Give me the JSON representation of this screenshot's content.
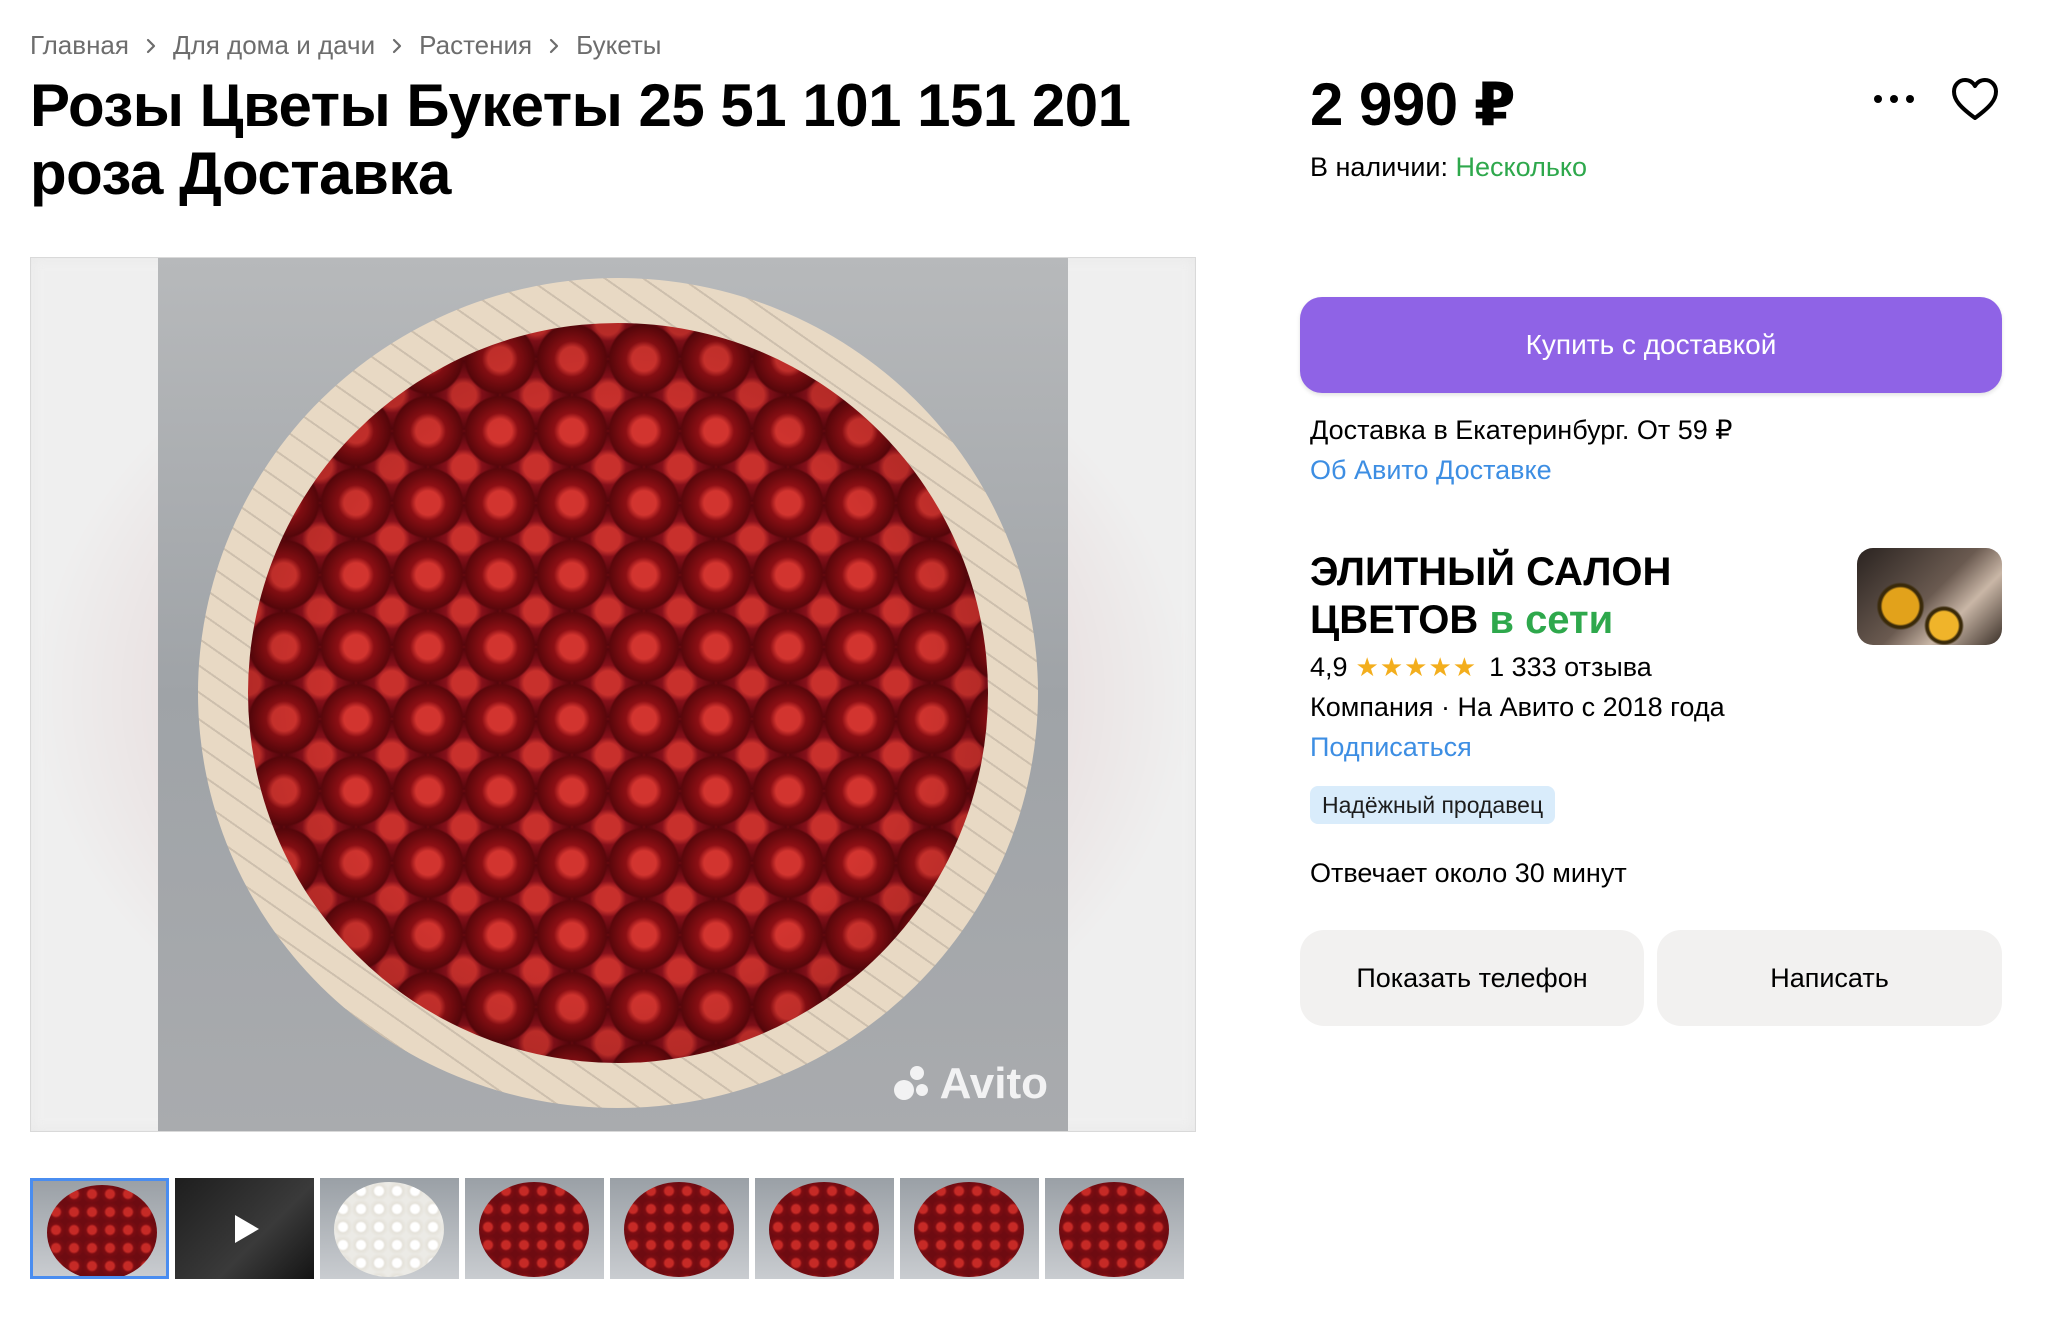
{
  "breadcrumbs": [
    "Главная",
    "Для дома и дачи",
    "Растения",
    "Букеты"
  ],
  "title": "Розы Цветы Букеты 25 51 101 151 201 роза Доставка",
  "gallery": {
    "watermark": "Avito",
    "thumbnails": [
      {
        "kind": "photo",
        "active": true
      },
      {
        "kind": "video",
        "icon": "play-icon"
      },
      {
        "kind": "photo-white"
      },
      {
        "kind": "photo"
      },
      {
        "kind": "photo"
      },
      {
        "kind": "photo"
      },
      {
        "kind": "photo"
      },
      {
        "kind": "photo"
      }
    ]
  },
  "price": "2 990 ₽",
  "stock": {
    "label": "В наличии:",
    "value": "Несколько"
  },
  "icons": {
    "more": "more-icon",
    "favorite": "heart-icon"
  },
  "buy_button": "Купить с доставкой",
  "delivery": {
    "text": "Доставка в Екатеринбург. От 59 ₽",
    "link": "Об Авито Доставке"
  },
  "seller": {
    "name": "ЭЛИТНЫЙ САЛОН ЦВЕТОВ",
    "status": "в сети",
    "rating": "4,9",
    "stars": 5,
    "reviews": "1 333 отзыва",
    "company": "Компания · На Авито с 2018 года",
    "subscribe": "Подписаться",
    "badge": "Надёжный продавец",
    "responds": "Отвечает около 30 минут"
  },
  "actions": {
    "phone": "Показать телефон",
    "write": "Написать"
  },
  "colors": {
    "accent": "#8f63e6",
    "link": "#3d8ee3",
    "online": "#2ea84c",
    "star": "#f3ae1d"
  }
}
